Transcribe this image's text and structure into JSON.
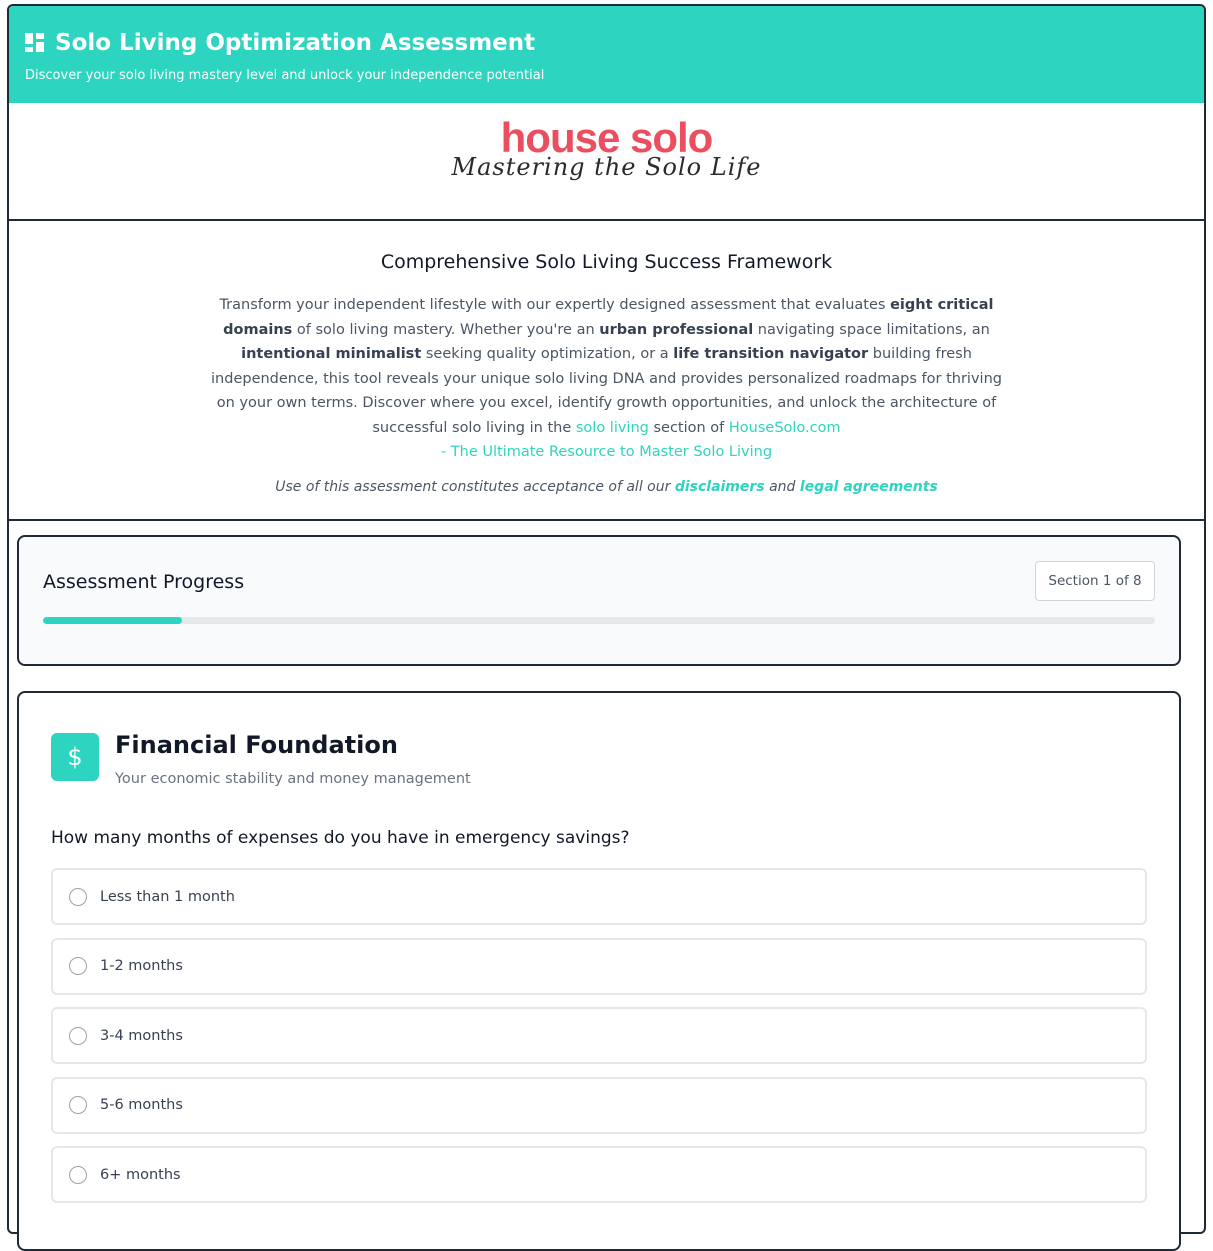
{
  "header": {
    "title": "Solo Living Optimization Assessment",
    "subtitle": "Discover your solo living mastery level and unlock your independence potential",
    "icon": "dashboard-icon"
  },
  "logo": {
    "main": "house solo",
    "tagline": "Mastering the Solo Life"
  },
  "intro": {
    "heading": "Comprehensive Solo Living Success Framework",
    "p1": "Transform your independent lifestyle with our expertly designed assessment that evaluates ",
    "b1": "eight critical domains",
    "p2": " of solo living mastery. Whether you're an ",
    "b2": "urban professional",
    "p3": " navigating space limitations, an ",
    "b3": "intentional minimalist",
    "p4": " seeking quality optimization, or a ",
    "b4": "life transition navigator",
    "p5": " building fresh independence, this tool reveals your unique solo living DNA and provides personalized roadmaps for thriving on your own terms. Discover where you excel, identify growth opportunities, and unlock the architecture of successful solo living in the ",
    "link1": "solo living",
    "p6": " section of ",
    "link2": "HouseSolo.com",
    "link3": "- The Ultimate Resource to Master Solo Living",
    "legal_pre": "Use of this assessment constitutes acceptance of all our ",
    "legal_link1": "disclaimers",
    "legal_mid": " and ",
    "legal_link2": "legal agreements"
  },
  "progress": {
    "title": "Assessment Progress",
    "section_label": "Section 1 of 8",
    "fraction": 0.125,
    "accent": "#2dd4bf"
  },
  "section": {
    "icon": "dollar-icon",
    "icon_glyph": "$",
    "title": "Financial Foundation",
    "subtitle": "Your economic stability and money management",
    "question": "How many months of expenses do you have in emergency savings?",
    "options": [
      "Less than 1 month",
      "1-2 months",
      "3-4 months",
      "5-6 months",
      "6+ months"
    ]
  }
}
